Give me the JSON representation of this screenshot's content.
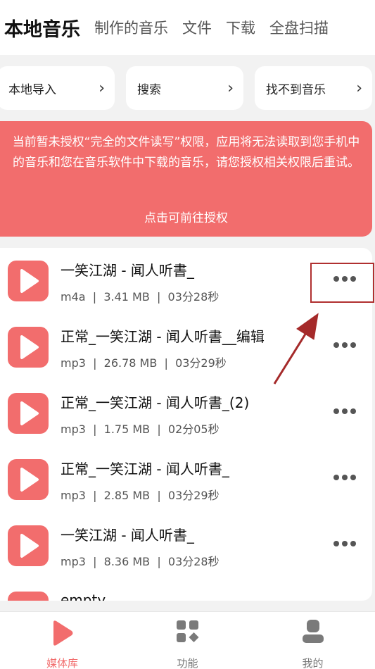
{
  "tabs": [
    {
      "label": "本地音乐",
      "active": true
    },
    {
      "label": "制作的音乐",
      "active": false
    },
    {
      "label": "文件",
      "active": false
    },
    {
      "label": "下载",
      "active": false
    },
    {
      "label": "全盘扫描",
      "active": false
    }
  ],
  "quick_actions": [
    {
      "label": "本地导入",
      "icon": "chevron-right-icon"
    },
    {
      "label": "搜索",
      "icon": "chevron-right-icon"
    },
    {
      "label": "找不到音乐",
      "icon": "chevron-right-icon"
    }
  ],
  "banner": {
    "message": "当前暂未授权“完全的文件读写”权限，应用将无法读取到您手机中的音乐和您在音乐软件中下载的音乐，请您授权相关权限后重试。",
    "action_label": "点击可前往授权"
  },
  "songs": [
    {
      "title": "一笑江湖 - 闻人听書_",
      "format": "m4a",
      "size": "3.41 MB",
      "duration": "03分28秒"
    },
    {
      "title": "正常_一笑江湖 - 闻人听書__编辑",
      "format": "mp3",
      "size": "26.78 MB",
      "duration": "03分29秒"
    },
    {
      "title": "正常_一笑江湖 - 闻人听書_(2)",
      "format": "mp3",
      "size": "1.75 MB",
      "duration": "02分05秒"
    },
    {
      "title": "正常_一笑江湖 - 闻人听書_",
      "format": "mp3",
      "size": "2.85 MB",
      "duration": "03分29秒"
    },
    {
      "title": "一笑江湖 - 闻人听書_",
      "format": "mp3",
      "size": "8.36 MB",
      "duration": "03分28秒"
    },
    {
      "title": "empty",
      "format": "",
      "size": "",
      "duration": ""
    }
  ],
  "meta_separator": "|",
  "bottom_nav": [
    {
      "label": "媒体库",
      "icon": "play-icon",
      "active": true
    },
    {
      "label": "功能",
      "icon": "grid-icon",
      "active": false
    },
    {
      "label": "我的",
      "icon": "profile-icon",
      "active": false
    }
  ],
  "colors": {
    "accent": "#f26d6d",
    "highlight": "#b03030"
  }
}
